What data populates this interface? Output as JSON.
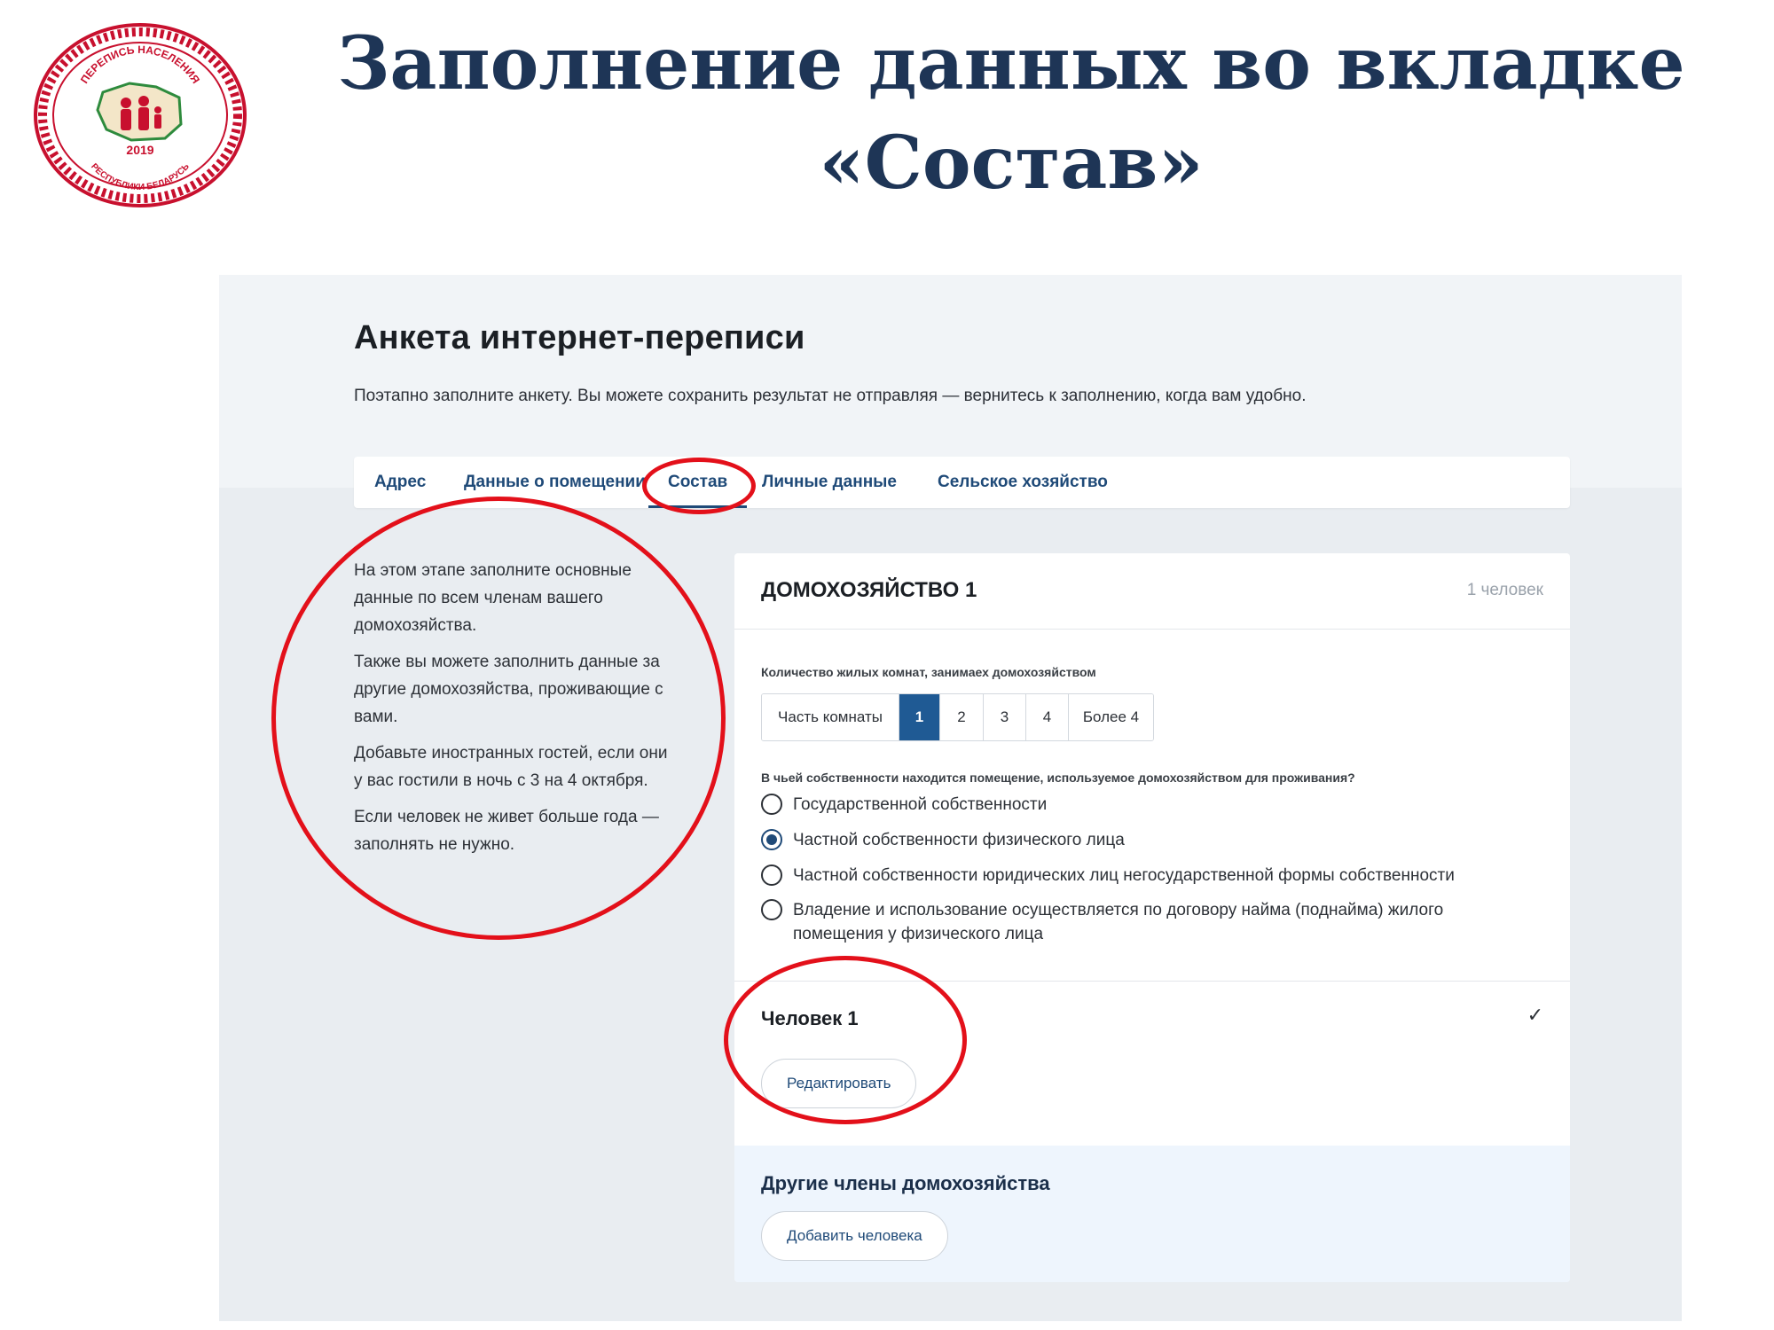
{
  "slide": {
    "title_line1": "Заполнение данных во вкладке",
    "title_line2": "«Состав»",
    "logo": {
      "top_text": "ПЕРЕПИСЬ НАСЕЛЕНИЯ",
      "year": "2019",
      "bottom_text": "РЕСПУБЛИКИ БЕЛАРУСЬ"
    }
  },
  "form": {
    "title": "Анкета интернет-переписи",
    "subtitle": "Поэтапно заполните анкету. Вы можете сохранить результат не отправляя — вернитесь к заполнению, когда вам удобно.",
    "tabs": [
      {
        "label": "Адрес",
        "active": false
      },
      {
        "label": "Данные о помещении",
        "active": false
      },
      {
        "label": "Состав",
        "active": true
      },
      {
        "label": "Личные данные",
        "active": false
      },
      {
        "label": "Сельское хозяйство",
        "active": false
      }
    ],
    "info": [
      "На этом этапе заполните основные данные по всем членам вашего домохозяйства.",
      "Также вы можете заполнить данные за другие домохозяйства, проживающие с вами.",
      "Добавьте иностранных гостей, если они у вас гостили в ночь с 3 на 4 октября.",
      "Если человек не живет больше года — заполнять не нужно."
    ]
  },
  "household": {
    "title": "ДОМОХОЗЯЙСТВО 1",
    "count": "1 человек",
    "rooms_label": "Количество жилых комнат, занимаех домохозяйством",
    "rooms_options": [
      "Часть комнаты",
      "1",
      "2",
      "3",
      "4",
      "Более 4"
    ],
    "rooms_selected": "1",
    "ownership_label": "В чьей собственности находится помещение, используемое домохозяйством для проживания?",
    "ownership_options": [
      {
        "label": "Государственной собственности",
        "checked": false
      },
      {
        "label": "Частной собственности физического лица",
        "checked": true
      },
      {
        "label": "Частной собственности юридических лиц негосударственной формы собственности",
        "checked": false
      },
      {
        "label": "Владение и использование осуществляется по договору найма (поднайма) жилого помещения у физического лица",
        "checked": false
      }
    ],
    "person": {
      "title": "Человек 1",
      "check_mark": "✓",
      "edit_label": "Редактировать"
    },
    "others": {
      "title": "Другие члены домохозяйства",
      "add_label": "Добавить человека"
    }
  },
  "colors": {
    "title": "#1e3556",
    "accent": "#1f5a94",
    "annotation": "#e3101a",
    "logo_red": "#c8102e"
  }
}
